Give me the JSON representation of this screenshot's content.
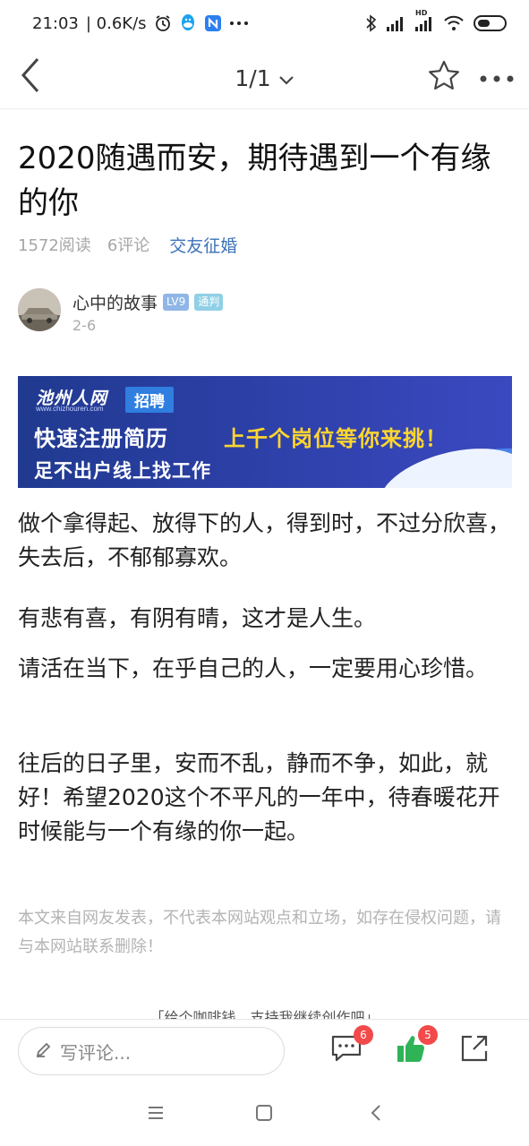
{
  "status_bar": {
    "time": "21:03",
    "network_speed": "| 0.6K/s",
    "left_icons": [
      "alarm-icon",
      "qq-icon",
      "notes-app-icon",
      "more-dots-icon"
    ],
    "right_icons": [
      "bluetooth-icon",
      "signal-icon",
      "hd-signal-icon",
      "wifi-icon",
      "battery-icon"
    ],
    "hd_label": "HD"
  },
  "nav": {
    "page_indicator": "1/1",
    "icons": [
      "back-icon",
      "chevron-down-icon",
      "star-icon",
      "more-icon"
    ]
  },
  "article": {
    "title": "2020随遇而安，期待遇到一个有缘的你",
    "reads": "1572阅读",
    "comments": "6评论",
    "category": "交友征婚",
    "author": {
      "name": "心中的故事",
      "level_badge": "LV9",
      "role_badge": "通判",
      "date": "2-6"
    },
    "banner": {
      "logo_text": "池州人网",
      "logo_sub": "www.chizhouren.com",
      "tag": "招聘",
      "line1": "快速注册简历",
      "line1_accent": "上千个岗位等你来挑！",
      "line2": "足不出户线上找工作"
    },
    "paragraphs": [
      "做个拿得起、放得下的人，得到时，不过分欣喜，失去后，不郁郁寡欢。",
      "有悲有喜，有阴有晴，这才是人生。",
      "请活在当下，在乎自己的人，一定要用心珍惜。",
      "往后的日子里，安而不乱，静而不争，如此，就好！希望2020这个不平凡的一年中，待春暖花开时候能与一个有缘的你一起。"
    ],
    "disclaimer": "本文来自网友发表，不代表本网站观点和立场，如存在侵权问题，请与本网站联系删除！",
    "cut_off_text": "「给个咖啡钱，支持我继续创作吧」"
  },
  "action_bar": {
    "comment_placeholder": "写评论...",
    "comment_count": "6",
    "like_count": "5",
    "icons": [
      "pencil-icon",
      "comment-icon",
      "thumbs-up-icon",
      "share-icon"
    ],
    "like_color": "#2fb357",
    "badge_color": "#f24a4a"
  },
  "system_nav": {
    "icons": [
      "menu-icon",
      "home-icon",
      "back-triangle-icon"
    ]
  }
}
